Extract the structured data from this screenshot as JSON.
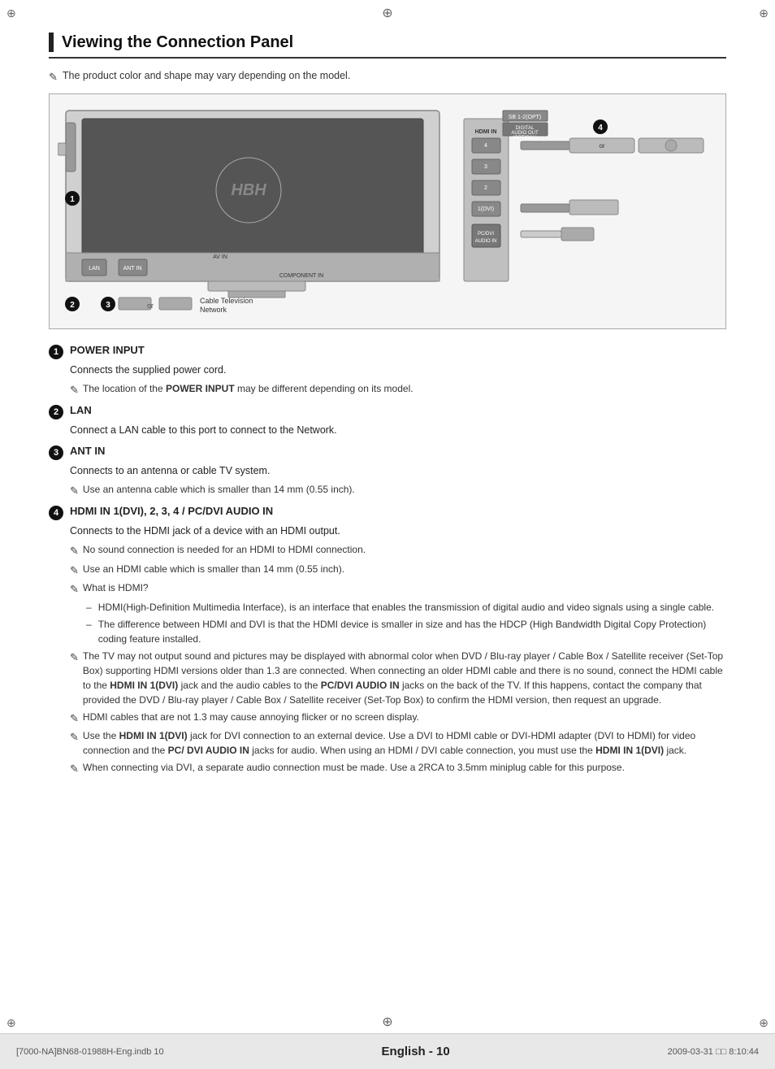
{
  "page": {
    "title": "Viewing the Connection Panel",
    "note_product": "The product color and shape may vary depending on the model.",
    "bottom_page_label": "English - 10",
    "bottom_file": "[7000-NA]BN68-01988H-Eng.indb   10",
    "bottom_date": "2009-03-31   □□ 8:10:44"
  },
  "items": [
    {
      "num": "1",
      "title": "POWER INPUT",
      "body": "Connects the supplied power cord.",
      "notes": [
        "The location of the POWER INPUT may be different depending on its model."
      ],
      "dashes": []
    },
    {
      "num": "2",
      "title": "LAN",
      "body": "Connect a LAN cable to this port to connect to the Network.",
      "notes": [],
      "dashes": []
    },
    {
      "num": "3",
      "title": "ANT IN",
      "body": "Connects to an antenna or cable TV system.",
      "notes": [
        "Use an antenna cable which is smaller than 14 mm (0.55 inch)."
      ],
      "dashes": []
    },
    {
      "num": "4",
      "title": "HDMI IN 1(DVI), 2, 3, 4 / PC/DVI AUDIO IN",
      "body": "Connects to the HDMI jack of a device with an HDMI output.",
      "notes": [
        "No sound connection is needed for an HDMI to HDMI connection.",
        "Use an HDMI cable which is smaller than 14 mm (0.55 inch).",
        "What is HDMI?"
      ],
      "dashes": [
        "HDMI(High-Definition Multimedia Interface), is an interface that enables the transmission of digital audio and video signals using a single cable.",
        "The difference between HDMI and DVI is that the HDMI device is smaller in size and has the HDCP (High Bandwidth Digital Copy Protection) coding feature installed."
      ],
      "extra_notes": [
        "The TV may not output sound and pictures may be displayed with abnormal color when DVD / Blu-ray player / Cable Box / Satellite receiver (Set-Top Box) supporting HDMI versions older than 1.3 are connected. When connecting an older HDMI cable and there is no sound, connect the HDMI cable to the HDMI IN 1(DVI) jack and the audio cables to the PC/DVI AUDIO IN jacks on the back of the TV. If this happens, contact the company that provided the DVD / Blu-ray player / Cable Box / Satellite receiver (Set-Top Box) to confirm the HDMI version, then request an upgrade.",
        "HDMI cables that are not 1.3 may cause annoying flicker or no screen display.",
        "Use the HDMI IN 1(DVI) jack for DVI connection to an external device. Use a DVI to HDMI cable or DVI-HDMI adapter (DVI to HDMI) for video connection and the PC/ DVI AUDIO IN jacks for audio. When using an HDMI / DVI cable connection, you must use the HDMI IN 1(DVI) jack.",
        "When connecting via DVI, a separate audio connection must be made. Use a 2RCA to 3.5mm miniplug cable for this purpose."
      ]
    }
  ]
}
